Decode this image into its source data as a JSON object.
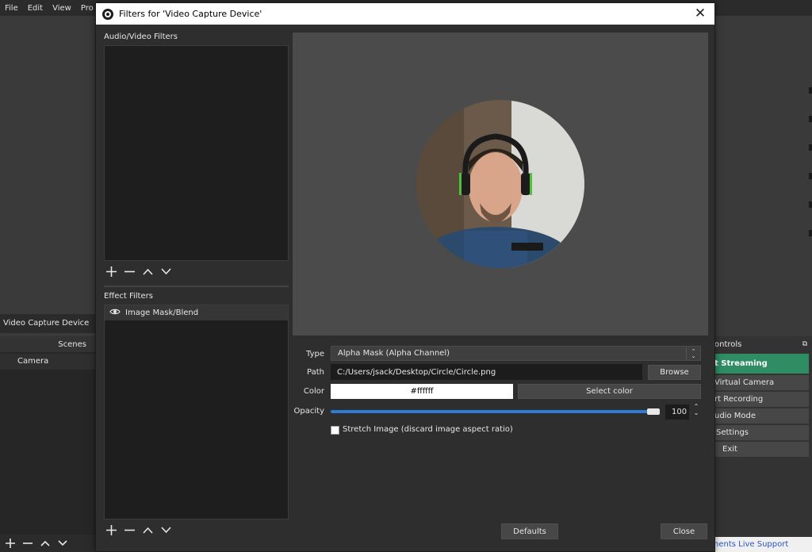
{
  "menu": {
    "items": [
      "File",
      "Edit",
      "View",
      "Pro"
    ]
  },
  "main": {
    "source_label": "Video Capture Device",
    "scenes_header": "Scenes",
    "scenes": [
      "Camera"
    ],
    "controls_header": "ontrols",
    "controls_buttons": {
      "streaming": "t Streaming",
      "virtual_camera": "Virtual Camera",
      "recording": "rt Recording",
      "studio_mode": "udio Mode",
      "settings": "Settings",
      "exit": "Exit"
    },
    "support_link": "nents Live Support"
  },
  "dialog": {
    "title": "Filters for 'Video Capture Device'",
    "audio_video_label": "Audio/Video Filters",
    "effect_filters_label": "Effect Filters",
    "effect_filters": [
      {
        "name": "Image Mask/Blend",
        "visible": true
      }
    ],
    "properties": {
      "type_label": "Type",
      "type_value": "Alpha Mask (Alpha Channel)",
      "path_label": "Path",
      "path_value": "C:/Users/jsack/Desktop/Circle/Circle.png",
      "browse_label": "Browse",
      "color_label": "Color",
      "color_value": "#ffffff",
      "select_color_label": "Select color",
      "opacity_label": "Opacity",
      "opacity_value": "100",
      "stretch_label": "Stretch Image (discard image aspect ratio)",
      "stretch_checked": false
    },
    "defaults_label": "Defaults",
    "close_label": "Close"
  },
  "colors": {
    "stream_button": "#2e8d63",
    "slider_fill": "#2f7bd1",
    "dialog_bg": "#2e2e2e",
    "preview_bg": "#4b4b4b"
  }
}
